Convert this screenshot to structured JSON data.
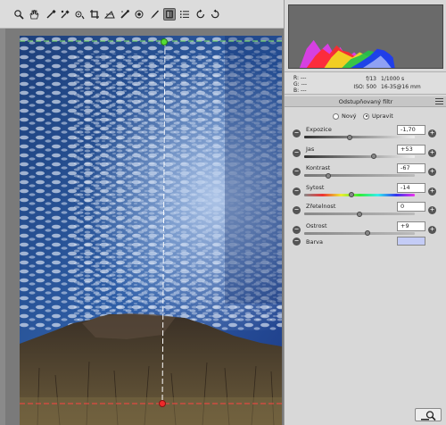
{
  "toolbar": {
    "tools": [
      "zoom-icon",
      "hand-icon",
      "eyedropper-icon",
      "color-sampler-icon",
      "target-adjust-icon",
      "crop-icon",
      "straighten-icon",
      "spot-removal-icon",
      "red-eye-icon",
      "adjustment-brush-icon",
      "graduated-filter-icon",
      "list-icon",
      "rotate-left-icon",
      "rotate-right-icon"
    ],
    "active_tool": "graduated-filter-icon"
  },
  "info": {
    "r": "R:  ---",
    "g": "G:  ---",
    "b": "B:  ---",
    "aperture": "f/13",
    "shutter": "1/1000 s",
    "iso": "ISO: 500",
    "lens": "16-35@16 mm"
  },
  "panel": {
    "title": "Odstupňovaný filtr",
    "mode_new": "Nový",
    "mode_edit": "Upravit",
    "selected_mode": "Upravit",
    "controls": [
      {
        "label": "Expozice",
        "value": "-1,70",
        "level": 0.41
      },
      {
        "label": "Jas",
        "value": "+53",
        "level": 0.63
      },
      {
        "label": "Kontrast",
        "value": "-67",
        "level": 0.22
      },
      {
        "label": "Sytost",
        "value": "-14",
        "level": 0.43
      },
      {
        "label": "Zřetelnost",
        "value": "0",
        "level": 0.5
      },
      {
        "label": "Ostrost",
        "value": "+9",
        "level": 0.57
      }
    ],
    "color_label": "Barva",
    "color_value": "#c4ccf6"
  },
  "colors": {
    "guide_top": "#66dd44",
    "guide_bottom": "#ee3333"
  }
}
